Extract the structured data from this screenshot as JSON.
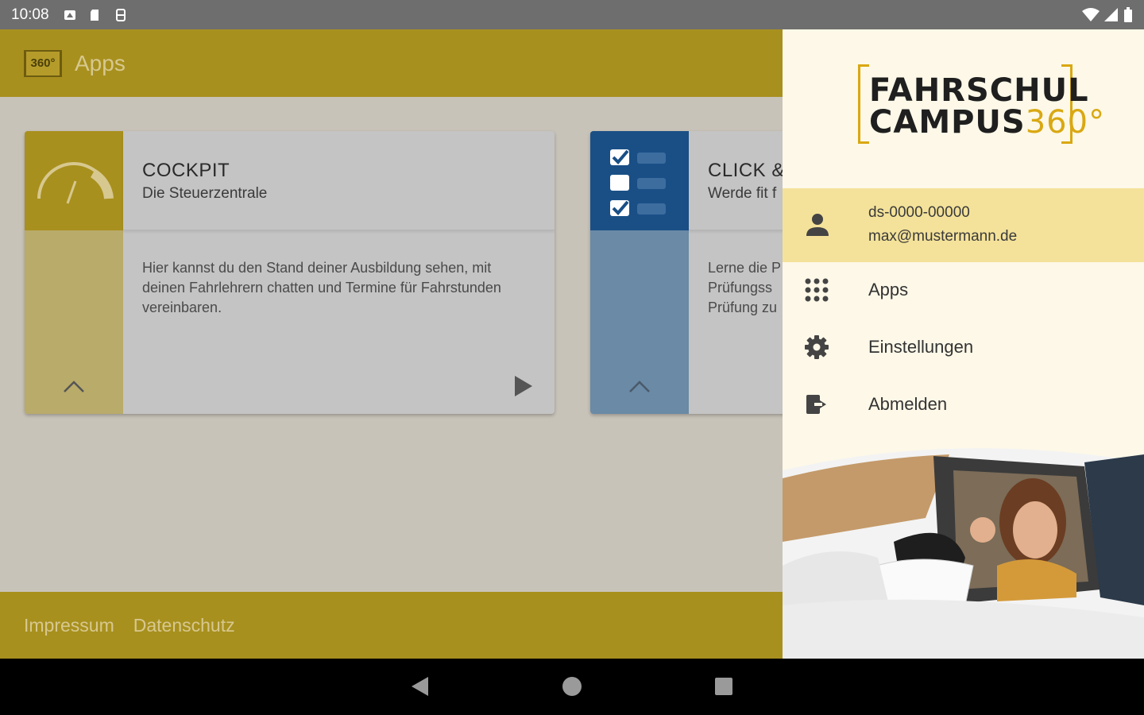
{
  "status_bar": {
    "time": "10:08"
  },
  "app_bar": {
    "logo_text": "360°",
    "title": "Apps"
  },
  "cards": [
    {
      "title": "COCKPIT",
      "subtitle": "Die Steuerzentrale",
      "description": "Hier kannst du den Stand deiner Ausbildung sehen, mit deinen Fahrlehrern chatten und Termine für Fahrstunden vereinbaren.",
      "accent": "#a8901e"
    },
    {
      "title": "CLICK &",
      "subtitle": "Werde fit f",
      "description": "Lerne die P\nPrüfungss\nPrüfung zu",
      "accent": "#1a4f86"
    }
  ],
  "footer": {
    "impressum": "Impressum",
    "datenschutz": "Datenschutz"
  },
  "drawer": {
    "brand_line1": "FAHRSCHUL",
    "brand_line2": "CAMPUS",
    "brand_num": "360°",
    "user_id": "ds-0000-00000",
    "user_email": "max@mustermann.de",
    "menu": [
      {
        "label": "Apps",
        "icon": "apps-grid-icon"
      },
      {
        "label": "Einstellungen",
        "icon": "gear-icon"
      },
      {
        "label": "Abmelden",
        "icon": "logout-icon"
      }
    ]
  },
  "colors": {
    "gold": "#a8901e",
    "brand_yellow": "#d9a812",
    "blue": "#1a4f86",
    "drawer_bg": "#fdf8e8",
    "highlight": "#f4e29a"
  }
}
